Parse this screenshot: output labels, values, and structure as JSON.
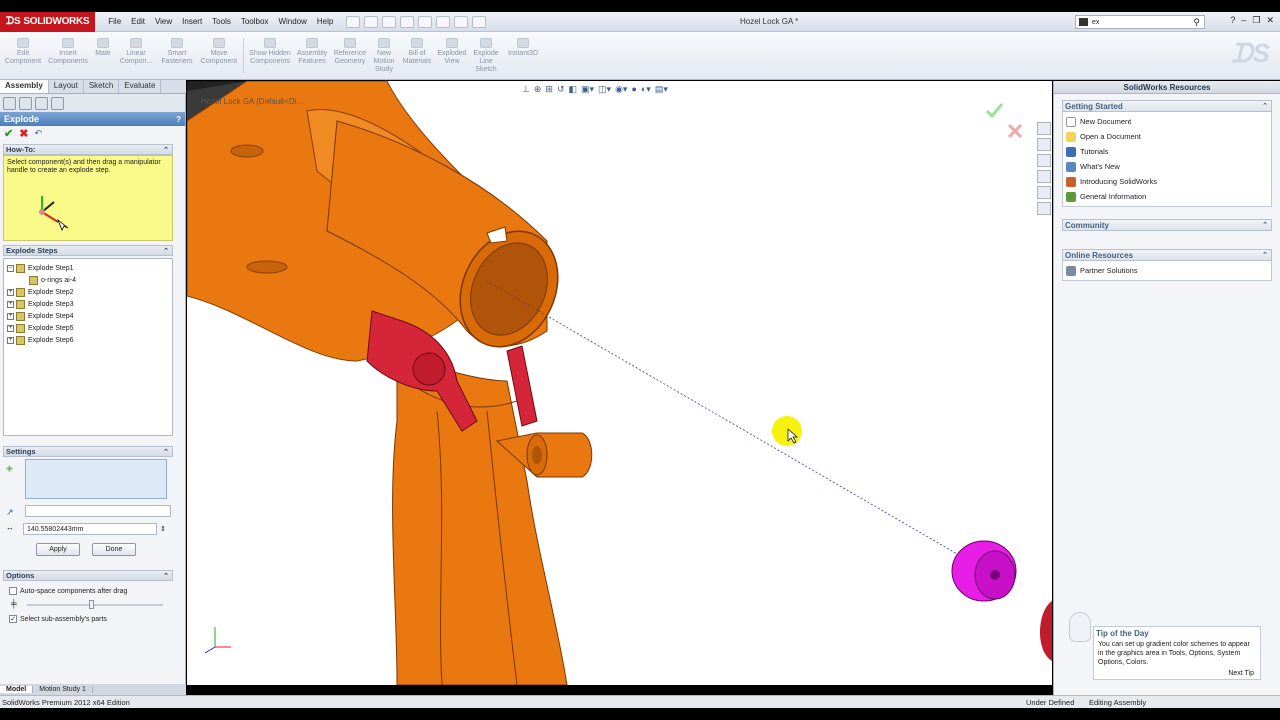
{
  "app": {
    "brand": "SOLIDWORKS",
    "title": "Hozel Lock GA *"
  },
  "menu": [
    "File",
    "Edit",
    "View",
    "Insert",
    "Tools",
    "Toolbox",
    "Window",
    "Help"
  ],
  "search": {
    "value": "ex"
  },
  "commands": [
    {
      "label": "Edit Component"
    },
    {
      "label": "Insert Components"
    },
    {
      "label": "Mate"
    },
    {
      "label": "Linear Compon..."
    },
    {
      "label": "Smart Fasteners"
    },
    {
      "label": "Move Component"
    },
    {
      "label": "Show Hidden Components"
    },
    {
      "label": "Assembly Features"
    },
    {
      "label": "Reference Geometry"
    },
    {
      "label": "New Motion Study"
    },
    {
      "label": "Bill of Materials"
    },
    {
      "label": "Exploded View"
    },
    {
      "label": "Explode Line Sketch"
    },
    {
      "label": "Instant3D"
    }
  ],
  "tabs": [
    {
      "label": "Assembly",
      "active": true
    },
    {
      "label": "Layout"
    },
    {
      "label": "Sketch"
    },
    {
      "label": "Evaluate"
    }
  ],
  "explode": {
    "title": "Explode",
    "howto_title": "How-To:",
    "howto_text": "Select component(s) and then drag a manipulator handle to create an explode step.",
    "steps_title": "Explode Steps",
    "steps": [
      "Explode Step1",
      "Explode Step2",
      "Explode Step3",
      "Explode Step4",
      "Explode Step5",
      "Explode Step6"
    ],
    "sub_item": "o-rings ai-4",
    "settings_title": "Settings",
    "distance": "140.55802443mm",
    "apply": "Apply",
    "done": "Done",
    "options_title": "Options",
    "opt_autospace": "Auto-space components after drag",
    "opt_subassembly": "Select sub-assembly's parts"
  },
  "bottom_tabs": [
    "Model",
    "Motion Study 1"
  ],
  "viewport": {
    "doc_name": "Hozel Lock GA  (Default<Di..."
  },
  "resources": {
    "title": "SolidWorks Resources",
    "getting_started": "Getting Started",
    "items": [
      "New Document",
      "Open a Document",
      "Tutorials",
      "What's New",
      "Introducing SolidWorks",
      "General Information"
    ],
    "community": "Community",
    "online": "Online Resources",
    "online_items": [
      "Partner Solutions"
    ],
    "tip_title": "Tip of the Day",
    "tip_text": "You can set up gradient color schemes to appear in the graphics area in Tools, Options, System Options, Colors.",
    "next_tip": "Next Tip"
  },
  "status": {
    "left": "SolidWorks Premium 2012 x64 Edition",
    "state": "Under Defined",
    "mode": "Editing Assembly"
  },
  "colors": {
    "orange": "#e8780f",
    "red": "#d42638",
    "magenta": "#e61ee6",
    "highlight": "#f5f000"
  }
}
